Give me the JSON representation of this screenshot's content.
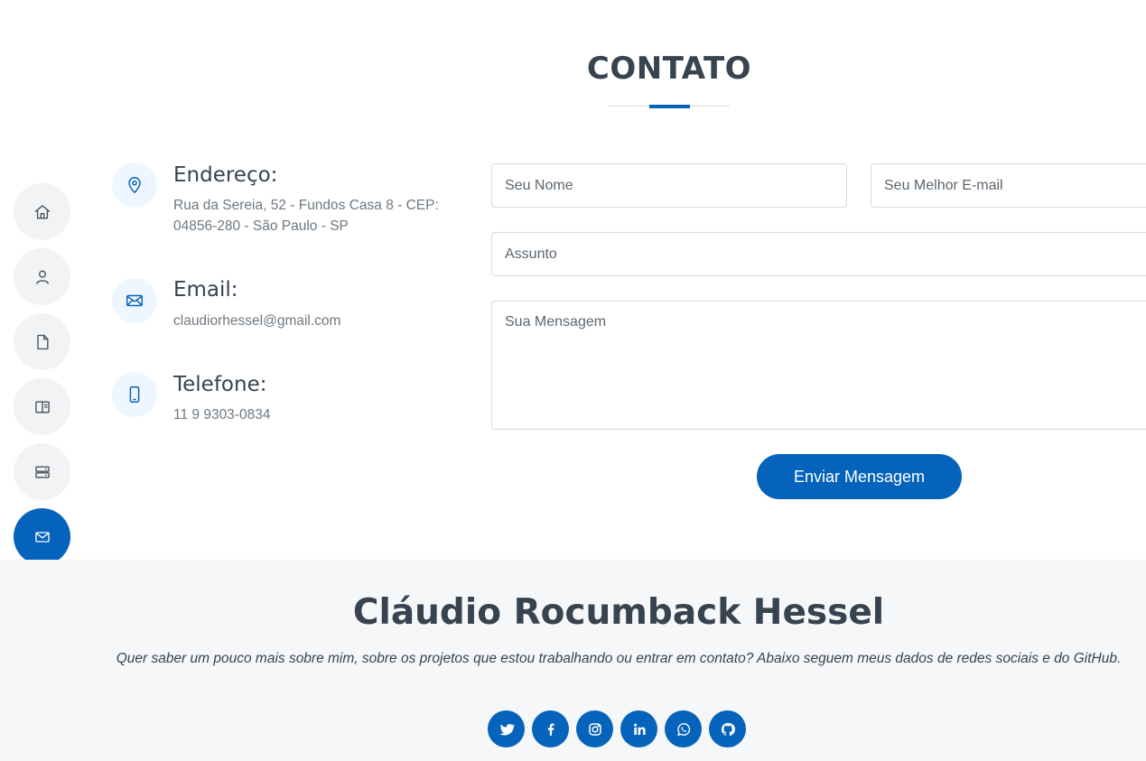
{
  "section": {
    "title": "CONTATO"
  },
  "nav": {
    "items": [
      {
        "icon": "home-icon"
      },
      {
        "icon": "user-icon"
      },
      {
        "icon": "file-icon"
      },
      {
        "icon": "book-icon"
      },
      {
        "icon": "server-icon"
      },
      {
        "icon": "envelope-icon",
        "active": true
      }
    ]
  },
  "info": {
    "address": {
      "icon": "map-pin-icon",
      "title": "Endereço:",
      "text": "Rua da Sereia, 52 - Fundos Casa 8 - CEP: 04856-280 - São Paulo - SP"
    },
    "email": {
      "icon": "envelope-icon",
      "title": "Email:",
      "text": "claudiorhessel@gmail.com"
    },
    "phone": {
      "icon": "phone-icon",
      "title": "Telefone:",
      "text": "11 9 9303-0834"
    }
  },
  "form": {
    "name_placeholder": "Seu Nome",
    "email_placeholder": "Seu Melhor E-mail",
    "subject_placeholder": "Assunto",
    "message_placeholder": "Sua Mensagem",
    "submit_label": "Enviar Mensagem"
  },
  "footer": {
    "name": "Cláudio Rocumback Hessel",
    "text": "Quer saber um pouco mais sobre mim, sobre os projetos que estou trabalhando ou entrar em contato? Abaixo seguem meus dados de redes sociais e do GitHub.",
    "socials": [
      "twitter-icon",
      "facebook-icon",
      "instagram-icon",
      "linkedin-icon",
      "whatsapp-icon",
      "github-icon"
    ]
  },
  "colors": {
    "accent": "#0563bb",
    "heading": "#37434f",
    "footer_bg": "#f6f7f9",
    "nav_bg": "#f2f3f5"
  }
}
